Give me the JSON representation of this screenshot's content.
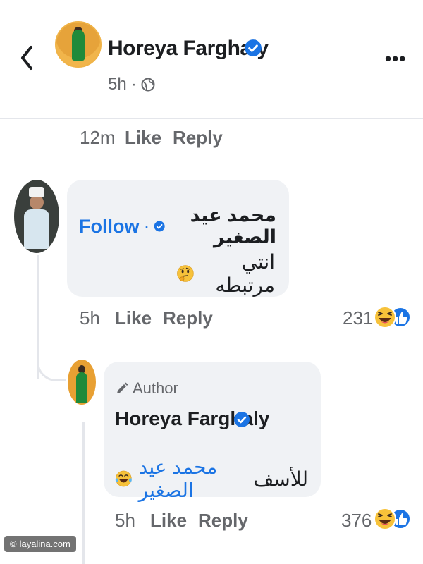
{
  "header": {
    "name": "Horeya Farghaly",
    "time": "5h",
    "separator": "·",
    "audience_icon": "globe-icon",
    "back_icon": "chevron-left-icon",
    "more_icon": "ellipsis-icon",
    "more_label": "•••"
  },
  "row1": {
    "time": "12m",
    "like": "Like",
    "reply": "Reply"
  },
  "comment1": {
    "follow": "Follow",
    "separator": "·",
    "name": "محمد عيد  الصغير",
    "text": "انتي مرتبطه",
    "emoji": "thinking-face-icon",
    "time": "5h",
    "like": "Like",
    "reply": "Reply",
    "reaction_count": "231",
    "reactions": [
      "laughing-icon",
      "like-icon"
    ]
  },
  "reply": {
    "author_badge": "Author",
    "name": "Horeya Farghaly",
    "mention": "محمد عيد الصغير",
    "text": "للأسف",
    "emoji": "tears-of-joy-icon",
    "time": "5h",
    "like": "Like",
    "reply": "Reply",
    "reaction_count": "376",
    "reactions": [
      "laughing-icon",
      "like-icon"
    ]
  },
  "watermark": "layalina.com",
  "colors": {
    "accent": "#1b74e4",
    "bubble": "#f0f2f5",
    "meta": "#65676b",
    "text": "#1c1e21"
  }
}
